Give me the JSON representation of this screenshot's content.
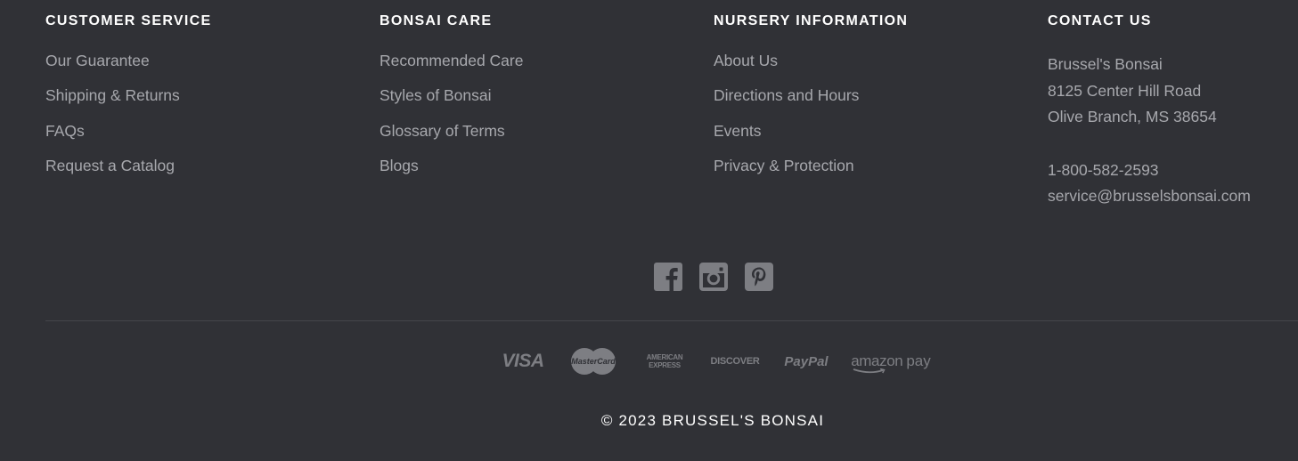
{
  "footer": {
    "columns": [
      {
        "heading": "CUSTOMER SERVICE",
        "links": [
          "Our Guarantee",
          "Shipping & Returns",
          "FAQs",
          "Request a Catalog"
        ]
      },
      {
        "heading": "BONSAI CARE",
        "links": [
          "Recommended Care",
          "Styles of Bonsai",
          "Glossary of Terms",
          "Blogs"
        ]
      },
      {
        "heading": "NURSERY INFORMATION",
        "links": [
          "About Us",
          "Directions and Hours",
          "Events",
          "Privacy & Protection"
        ]
      }
    ],
    "contact": {
      "heading": "CONTACT US",
      "company": "Brussel's Bonsai",
      "address_line1": "8125 Center Hill Road",
      "address_line2": "Olive Branch, MS 38654",
      "phone": "1-800-582-2593",
      "email": "service@brusselsbonsai.com"
    },
    "social_icons": [
      "facebook-icon",
      "instagram-icon",
      "pinterest-icon"
    ],
    "payment_methods": {
      "visa": "VISA",
      "mastercard": "MasterCard",
      "amex_line1": "AMERICAN",
      "amex_line2": "EXPRESS",
      "discover": "DISCOVER",
      "paypal": "PayPal",
      "amazon_pay_word": "amazon",
      "amazon_pay_suffix": "pay"
    },
    "copyright": "© 2023 BRUSSEL'S BONSAI",
    "colors": {
      "background": "#303136",
      "heading": "#ffffff",
      "link": "#a7a8ad",
      "icon": "#7d7e83",
      "divider": "#45464b"
    }
  }
}
